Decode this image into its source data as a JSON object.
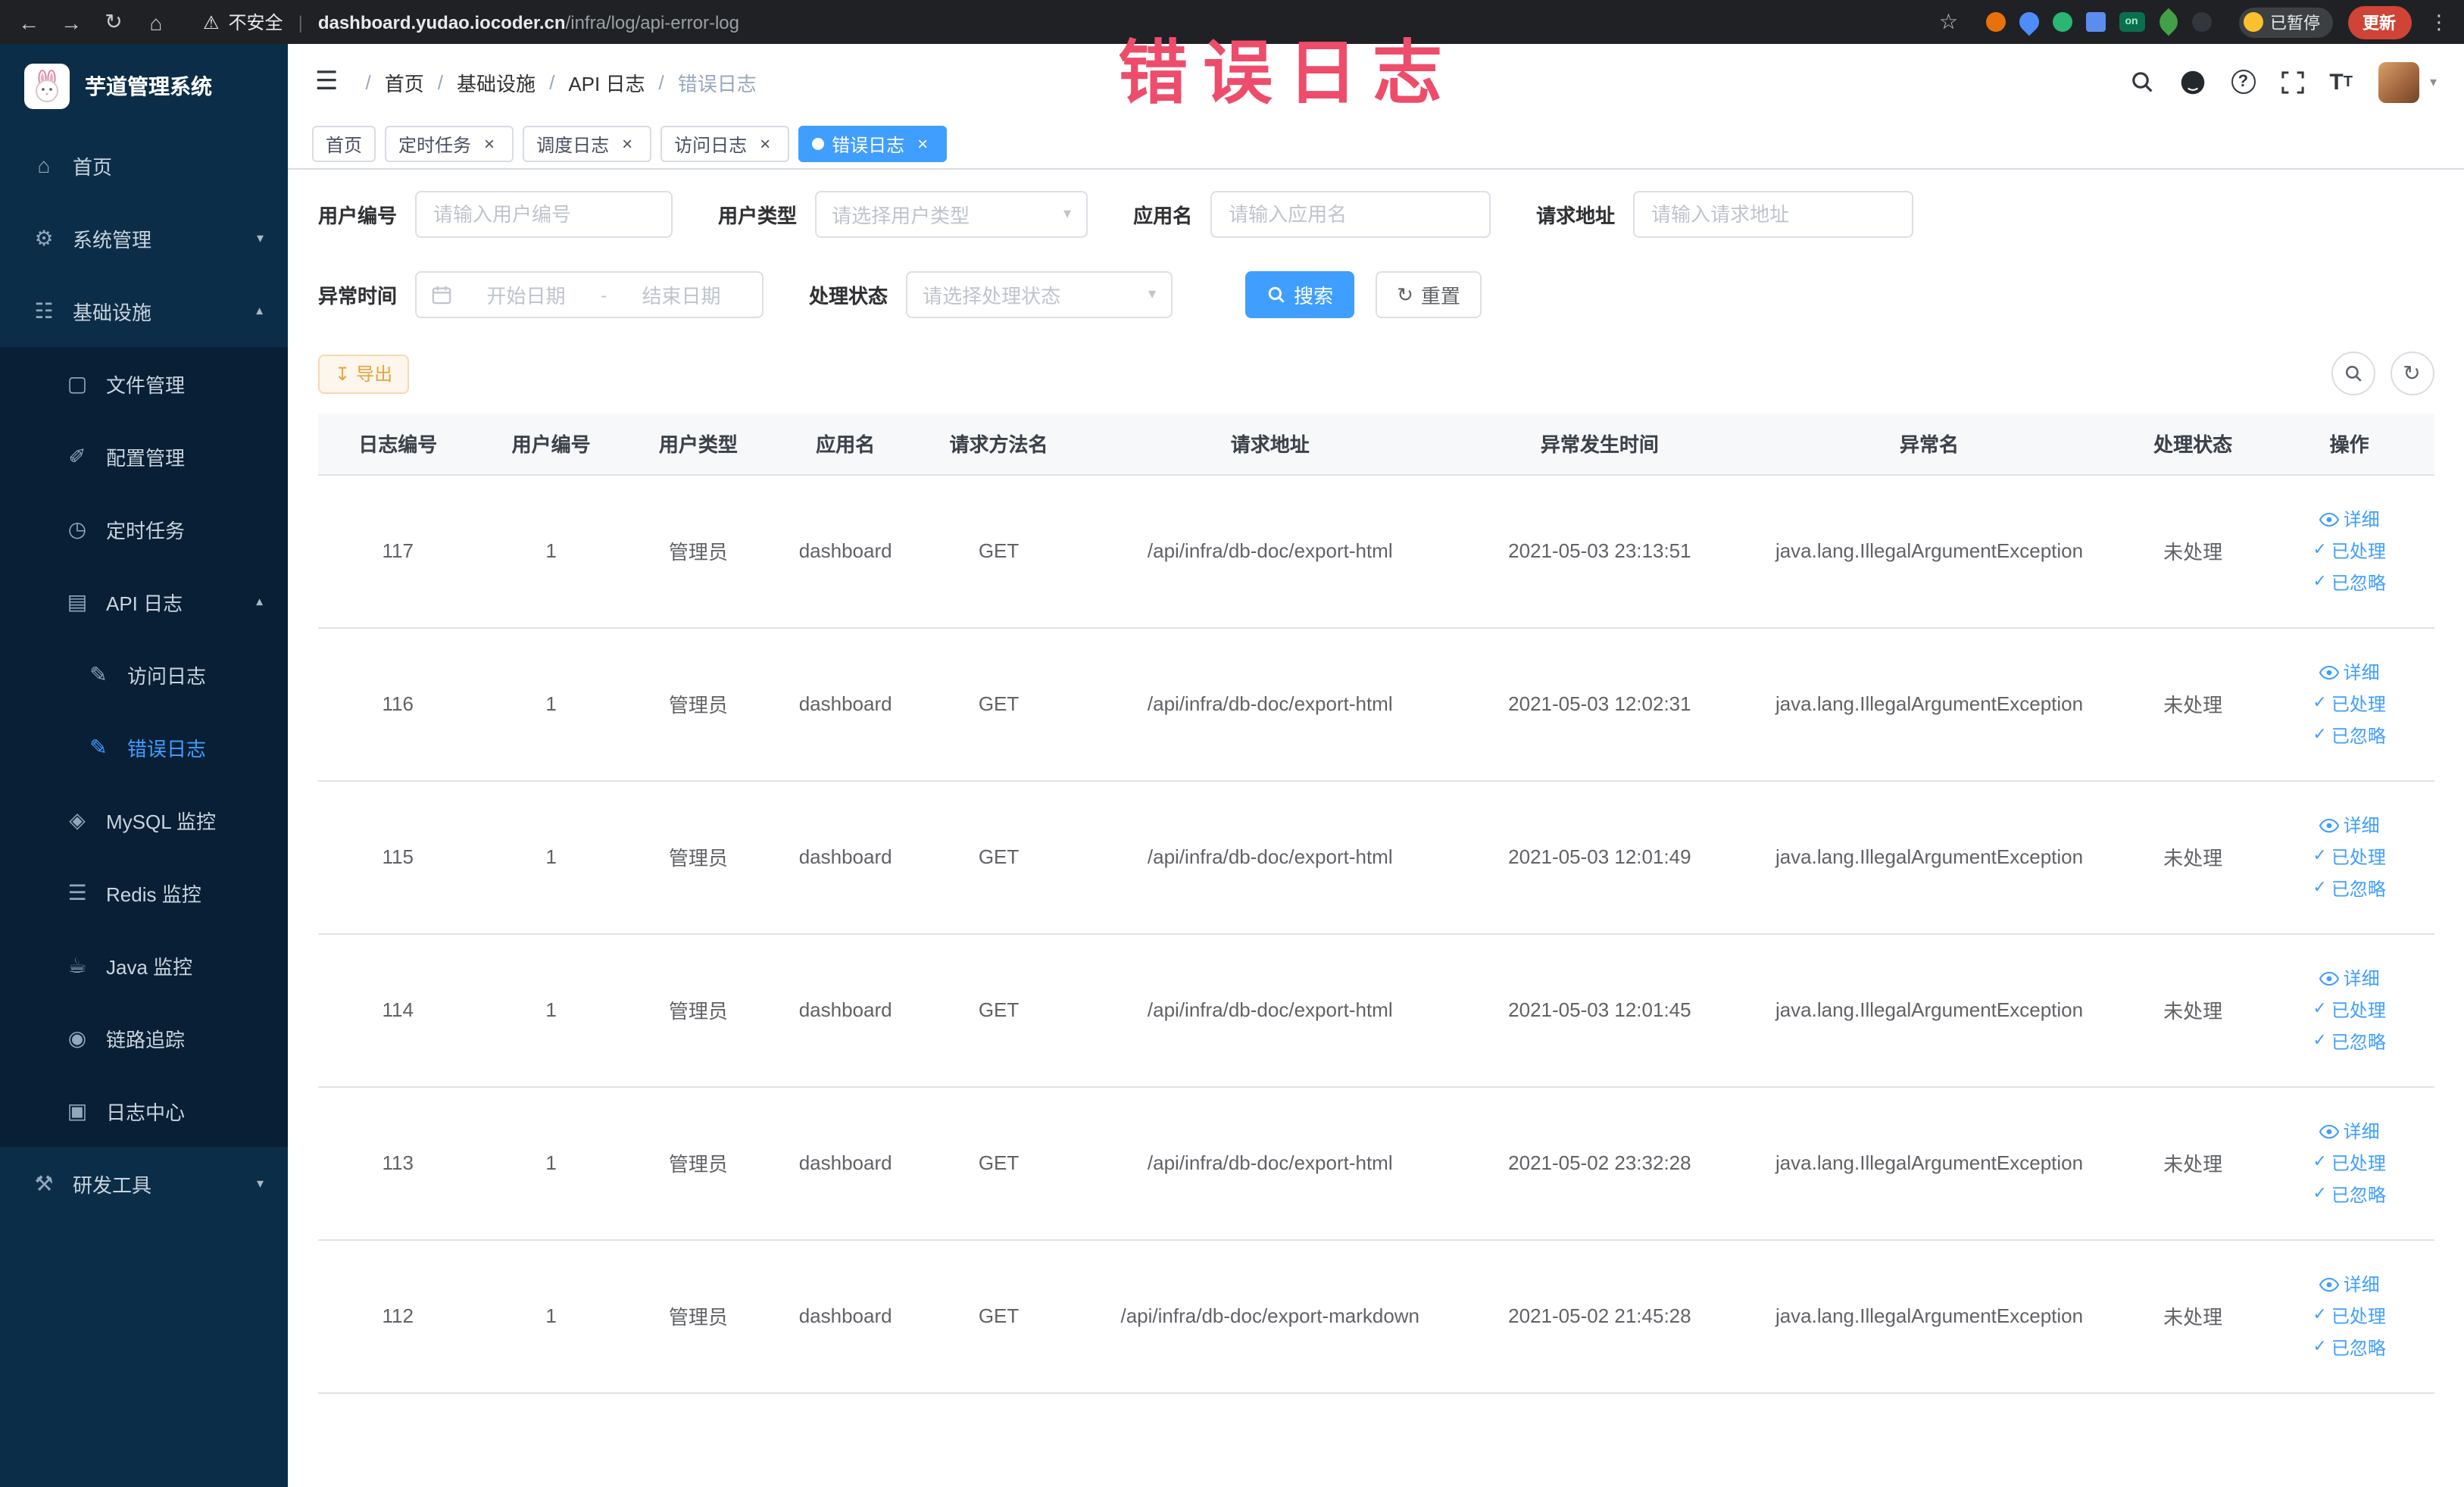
{
  "watermark": "错误日志",
  "browser": {
    "warning": "不安全",
    "url_host": "dashboard.yudao.iocoder.cn",
    "url_path": "/infra/log/api-error-log",
    "paused_badge": "已暂停",
    "update_button": "更新",
    "extensions": [
      {
        "name": "record-ext-icon",
        "color": "#e8710a",
        "shape": "circle"
      },
      {
        "name": "drop-ext-icon",
        "color": "#4e8cf9",
        "shape": "drop"
      },
      {
        "name": "video-ext-icon",
        "color": "#2bb673",
        "shape": "circle"
      },
      {
        "name": "grid-ext-icon",
        "color": "#5b8def",
        "shape": "grid"
      },
      {
        "name": "on-badge-ext-icon",
        "color": "#0b6e4f",
        "shape": "badge",
        "text": "on"
      },
      {
        "name": "leaf-ext-icon",
        "color": "#43a047",
        "shape": "leaf"
      },
      {
        "name": "paw-ext-icon",
        "color": "#33373b",
        "shape": "circle"
      }
    ]
  },
  "sidebar": {
    "logo_title": "芋道管理系统",
    "menu": [
      {
        "label": "首页",
        "icon": "home-icon",
        "level": 0
      },
      {
        "label": "系统管理",
        "icon": "gear-icon",
        "level": 0,
        "arrow": "down"
      },
      {
        "label": "基础设施",
        "icon": "infra-icon",
        "level": 0,
        "arrow": "up"
      },
      {
        "label": "文件管理",
        "icon": "file-icon",
        "level": 1
      },
      {
        "label": "配置管理",
        "icon": "config-icon",
        "level": 1
      },
      {
        "label": "定时任务",
        "icon": "timer-icon",
        "level": 1
      },
      {
        "label": "API 日志",
        "icon": "api-log-icon",
        "level": 1,
        "arrow": "up"
      },
      {
        "label": "访问日志",
        "icon": "access-log-icon",
        "level": 2
      },
      {
        "label": "错误日志",
        "icon": "error-log-icon",
        "level": 2,
        "active": true
      },
      {
        "label": "MySQL 监控",
        "icon": "mysql-icon",
        "level": 1
      },
      {
        "label": "Redis 监控",
        "icon": "redis-icon",
        "level": 1
      },
      {
        "label": "Java 监控",
        "icon": "java-icon",
        "level": 1
      },
      {
        "label": "链路追踪",
        "icon": "trace-icon",
        "level": 1
      },
      {
        "label": "日志中心",
        "icon": "log-center-icon",
        "level": 1
      },
      {
        "label": "研发工具",
        "icon": "devtools-icon",
        "level": 0,
        "arrow": "down"
      }
    ]
  },
  "breadcrumb": [
    "首页",
    "基础设施",
    "API 日志",
    "错误日志"
  ],
  "header": {
    "icon_names": [
      "search-icon",
      "github-icon",
      "help-icon",
      "fullscreen-icon",
      "font-size-icon",
      "user-avatar",
      "chevron-down-icon"
    ]
  },
  "tabs": [
    {
      "label": "首页"
    },
    {
      "label": "定时任务",
      "closable": true
    },
    {
      "label": "调度日志",
      "closable": true
    },
    {
      "label": "访问日志",
      "closable": true
    },
    {
      "label": "错误日志",
      "closable": true,
      "active": true
    }
  ],
  "filters": {
    "user_id_label": "用户编号",
    "user_id_placeholder": "请输入用户编号",
    "user_type_label": "用户类型",
    "user_type_placeholder": "请选择用户类型",
    "app_name_label": "应用名",
    "app_name_placeholder": "请输入应用名",
    "request_url_label": "请求地址",
    "request_url_placeholder": "请输入请求地址",
    "exception_time_label": "异常时间",
    "start_date_placeholder": "开始日期",
    "date_separator": "-",
    "end_date_placeholder": "结束日期",
    "process_status_label": "处理状态",
    "process_status_placeholder": "请选择处理状态",
    "search_button": "搜索",
    "reset_button": "重置"
  },
  "toolbar": {
    "export_button": "导出"
  },
  "table": {
    "columns": [
      "日志编号",
      "用户编号",
      "用户类型",
      "应用名",
      "请求方法名",
      "请求地址",
      "异常发生时间",
      "异常名",
      "处理状态",
      "操作"
    ],
    "actions": [
      "详细",
      "已处理",
      "已忽略"
    ],
    "rows": [
      {
        "id": "117",
        "user_id": "1",
        "user_type": "管理员",
        "app": "dashboard",
        "method": "GET",
        "url": "/api/infra/db-doc/export-html",
        "time": "2021-05-03 23:13:51",
        "exception": "java.lang.IllegalArgumentException",
        "status": "未处理"
      },
      {
        "id": "116",
        "user_id": "1",
        "user_type": "管理员",
        "app": "dashboard",
        "method": "GET",
        "url": "/api/infra/db-doc/export-html",
        "time": "2021-05-03 12:02:31",
        "exception": "java.lang.IllegalArgumentException",
        "status": "未处理"
      },
      {
        "id": "115",
        "user_id": "1",
        "user_type": "管理员",
        "app": "dashboard",
        "method": "GET",
        "url": "/api/infra/db-doc/export-html",
        "time": "2021-05-03 12:01:49",
        "exception": "java.lang.IllegalArgumentException",
        "status": "未处理"
      },
      {
        "id": "114",
        "user_id": "1",
        "user_type": "管理员",
        "app": "dashboard",
        "method": "GET",
        "url": "/api/infra/db-doc/export-html",
        "time": "2021-05-03 12:01:45",
        "exception": "java.lang.IllegalArgumentException",
        "status": "未处理"
      },
      {
        "id": "113",
        "user_id": "1",
        "user_type": "管理员",
        "app": "dashboard",
        "method": "GET",
        "url": "/api/infra/db-doc/export-html",
        "time": "2021-05-02 23:32:28",
        "exception": "java.lang.IllegalArgumentException",
        "status": "未处理"
      },
      {
        "id": "112",
        "user_id": "1",
        "user_type": "管理员",
        "app": "dashboard",
        "method": "GET",
        "url": "/api/infra/db-doc/export-markdown",
        "time": "2021-05-02 21:45:28",
        "exception": "java.lang.IllegalArgumentException",
        "status": "未处理"
      }
    ]
  },
  "colors": {
    "accent_blue": "#409eff",
    "warning_orange": "#e6a23c",
    "sidebar_navy": "#0c2d48",
    "watermark_red": "#ee4c6b"
  }
}
